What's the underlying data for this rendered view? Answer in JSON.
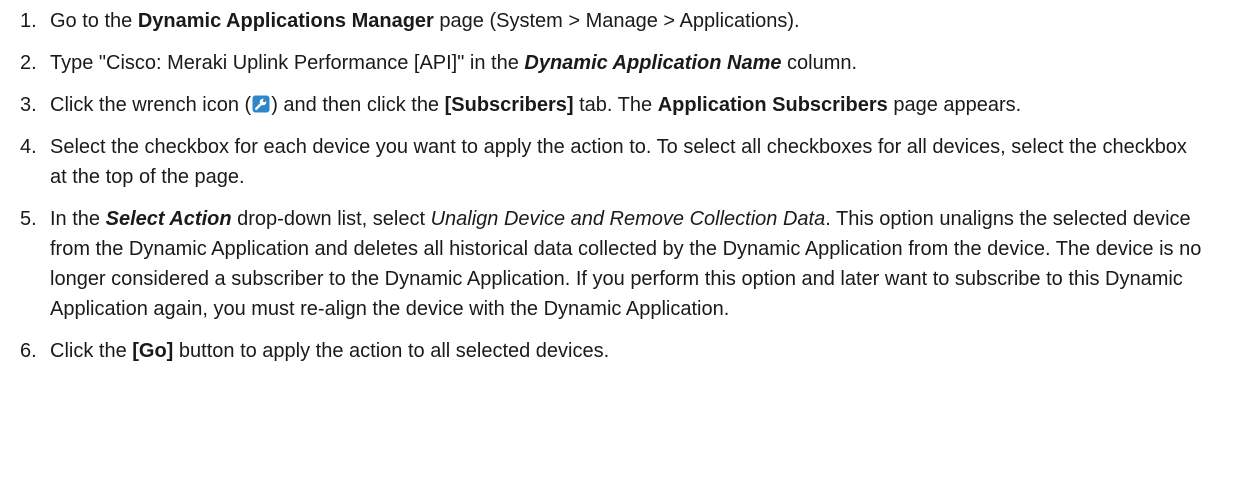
{
  "steps": [
    {
      "num": "1.",
      "parts": [
        "Go to the ",
        "Dynamic Applications Manager",
        " page (System > Manage > Applications)."
      ]
    },
    {
      "num": "2.",
      "parts": [
        "Type \"Cisco: Meraki Uplink Performance [API]\" in the ",
        "Dynamic Application Name",
        " column."
      ]
    },
    {
      "num": "3.",
      "parts": [
        " Click the wrench icon (",
        ") and then click the ",
        "[Subscribers]",
        " tab. The ",
        "Application Subscribers",
        " page appears."
      ]
    },
    {
      "num": "4.",
      "parts": [
        "Select the checkbox for each device you want to apply the action to. To select all checkboxes for all devices, select the checkbox at the top of the page."
      ]
    },
    {
      "num": "5.",
      "parts": [
        "In the ",
        "Select Action",
        " drop-down list, select ",
        "Unalign Device and Remove Collection Data",
        ". This option unaligns the selected device from the Dynamic Application and deletes all historical data collected by the Dynamic Application from the device. The device is no longer considered a subscriber to the Dynamic Application. If you perform this option and later want to subscribe to this Dynamic Application again, you must re-align the device with the Dynamic Application."
      ]
    },
    {
      "num": "6.",
      "parts": [
        "Click the ",
        "[Go]",
        " button to apply the action to all selected devices."
      ]
    }
  ],
  "icons": {
    "wrench": "wrench-icon",
    "wrench_color": "#2f86c9"
  }
}
